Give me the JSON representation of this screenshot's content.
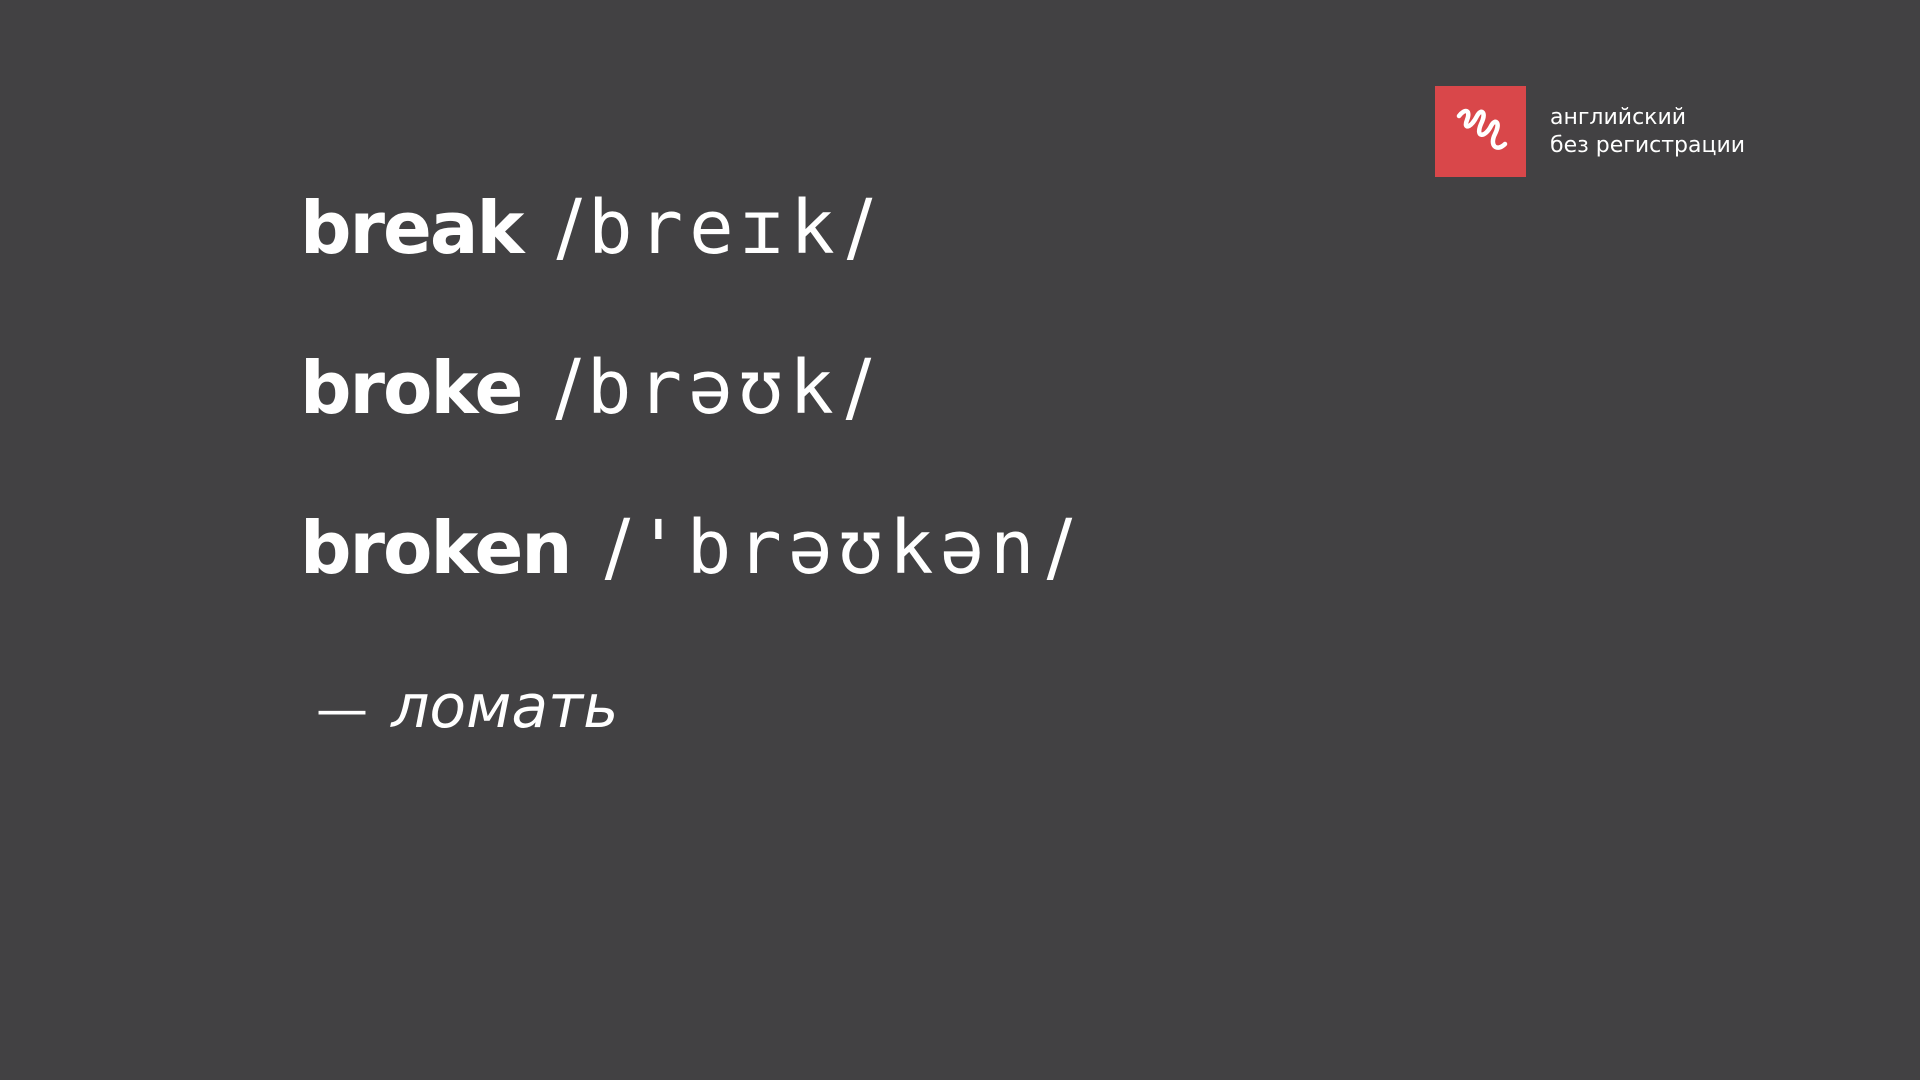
{
  "brand": {
    "line1": "английский",
    "line2": "без регистрации",
    "accent": "#d9474a",
    "icon": "squiggle-logo-icon"
  },
  "colors": {
    "background": "#424143",
    "text": "#ffffff"
  },
  "forms": [
    {
      "word": "break",
      "open_slash": "/",
      "transcription": "breɪk",
      "close_slash": "/"
    },
    {
      "word": "broke",
      "open_slash": "/",
      "transcription": "brəʊk",
      "close_slash": "/"
    },
    {
      "word": "broken",
      "open_slash": "/",
      "transcription": "'brəʊkən",
      "close_slash": "/"
    }
  ],
  "translation": {
    "dash": "—",
    "text": "ломать"
  }
}
